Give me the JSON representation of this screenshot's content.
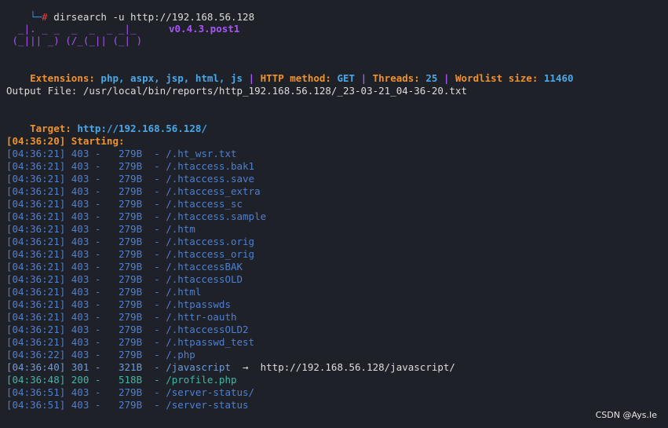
{
  "prompt": {
    "bracket": "└─",
    "hash": "#",
    "command": " dirsearch -u http://192.168.56.128"
  },
  "banner": {
    "line1": "  _|. _ _  _  _  _ _|_",
    "line2": " (_||| _) (/_(_|| (_| )",
    "version": "v0.4.3.post1"
  },
  "config": {
    "ext_label": "Extensions: ",
    "ext_value": "php, aspx, jsp, html, js",
    "method_label": "HTTP method: ",
    "method_value": "GET",
    "threads_label": "Threads: ",
    "threads_value": "25",
    "wordlist_label": "Wordlist size: ",
    "wordlist_value": "11460",
    "sep": " | "
  },
  "output_file": "Output File: /usr/local/bin/reports/http_192.168.56.128/_23-03-21_04-36-20.txt",
  "target": {
    "label": "Target: ",
    "value": "http://192.168.56.128/"
  },
  "starting": "[04:36:20] Starting:",
  "results": [
    {
      "text": "[04:36:21] 403 -   279B  - /.ht_wsr.txt",
      "status": "403"
    },
    {
      "text": "[04:36:21] 403 -   279B  - /.htaccess.bak1",
      "status": "403"
    },
    {
      "text": "[04:36:21] 403 -   279B  - /.htaccess.save",
      "status": "403"
    },
    {
      "text": "[04:36:21] 403 -   279B  - /.htaccess_extra",
      "status": "403"
    },
    {
      "text": "[04:36:21] 403 -   279B  - /.htaccess_sc",
      "status": "403"
    },
    {
      "text": "[04:36:21] 403 -   279B  - /.htaccess.sample",
      "status": "403"
    },
    {
      "text": "[04:36:21] 403 -   279B  - /.htm",
      "status": "403"
    },
    {
      "text": "[04:36:21] 403 -   279B  - /.htaccess.orig",
      "status": "403"
    },
    {
      "text": "[04:36:21] 403 -   279B  - /.htaccess_orig",
      "status": "403"
    },
    {
      "text": "[04:36:21] 403 -   279B  - /.htaccessBAK",
      "status": "403"
    },
    {
      "text": "[04:36:21] 403 -   279B  - /.htaccessOLD",
      "status": "403"
    },
    {
      "text": "[04:36:21] 403 -   279B  - /.html",
      "status": "403"
    },
    {
      "text": "[04:36:21] 403 -   279B  - /.htpasswds",
      "status": "403"
    },
    {
      "text": "[04:36:21] 403 -   279B  - /.httr-oauth",
      "status": "403"
    },
    {
      "text": "[04:36:21] 403 -   279B  - /.htaccessOLD2",
      "status": "403"
    },
    {
      "text": "[04:36:21] 403 -   279B  - /.htpasswd_test",
      "status": "403"
    },
    {
      "text": "[04:36:22] 403 -   279B  - /.php",
      "status": "403"
    },
    {
      "text": "[04:36:40] 301 -   321B  - /javascript",
      "status": "301",
      "redirect": "  →  http://192.168.56.128/javascript/"
    },
    {
      "text": "[04:36:48] 200 -   518B  - /profile.php",
      "status": "200"
    },
    {
      "text": "[04:36:51] 403 -   279B  - /server-status/",
      "status": "403"
    },
    {
      "text": "[04:36:51] 403 -   279B  - /server-status",
      "status": "403"
    }
  ],
  "watermark": "CSDN @Ays.Ie"
}
